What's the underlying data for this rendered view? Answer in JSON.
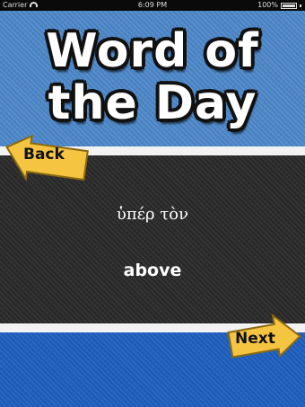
{
  "status_bar": {
    "carrier": "Carrier",
    "time": "6:09 PM",
    "battery": "100%"
  },
  "header": {
    "line1": "Word of",
    "line2": "the Day"
  },
  "buttons": {
    "back_label": "Back",
    "next_label": "Next"
  },
  "word": {
    "greek": "ὑπέρ τὸν",
    "english": "above"
  },
  "colors": {
    "top_bg": "#4d87c9",
    "middle_bg": "#2c2c2c",
    "bottom_bg": "#1f5fbf",
    "arrow": "#f5c542"
  }
}
